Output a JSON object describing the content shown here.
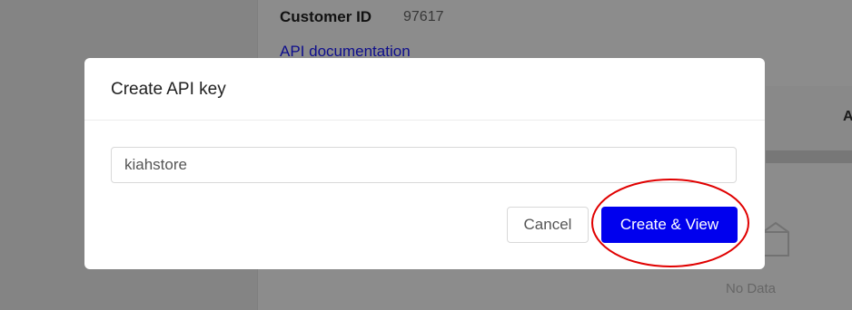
{
  "background": {
    "customer_id_label": "Customer ID",
    "customer_id_value": "97617",
    "api_documentation_link": "API documentation",
    "table_header_partial": "A",
    "empty_state_text": "No Data",
    "empty_icon": "empty-box-icon"
  },
  "modal": {
    "title": "Create API key",
    "key_input_value": "kiahstore",
    "cancel_label": "Cancel",
    "create_label": "Create & View"
  },
  "colors": {
    "primary_button": "#0000ee",
    "link": "#1a1aff",
    "highlight_ring": "#e00000"
  }
}
